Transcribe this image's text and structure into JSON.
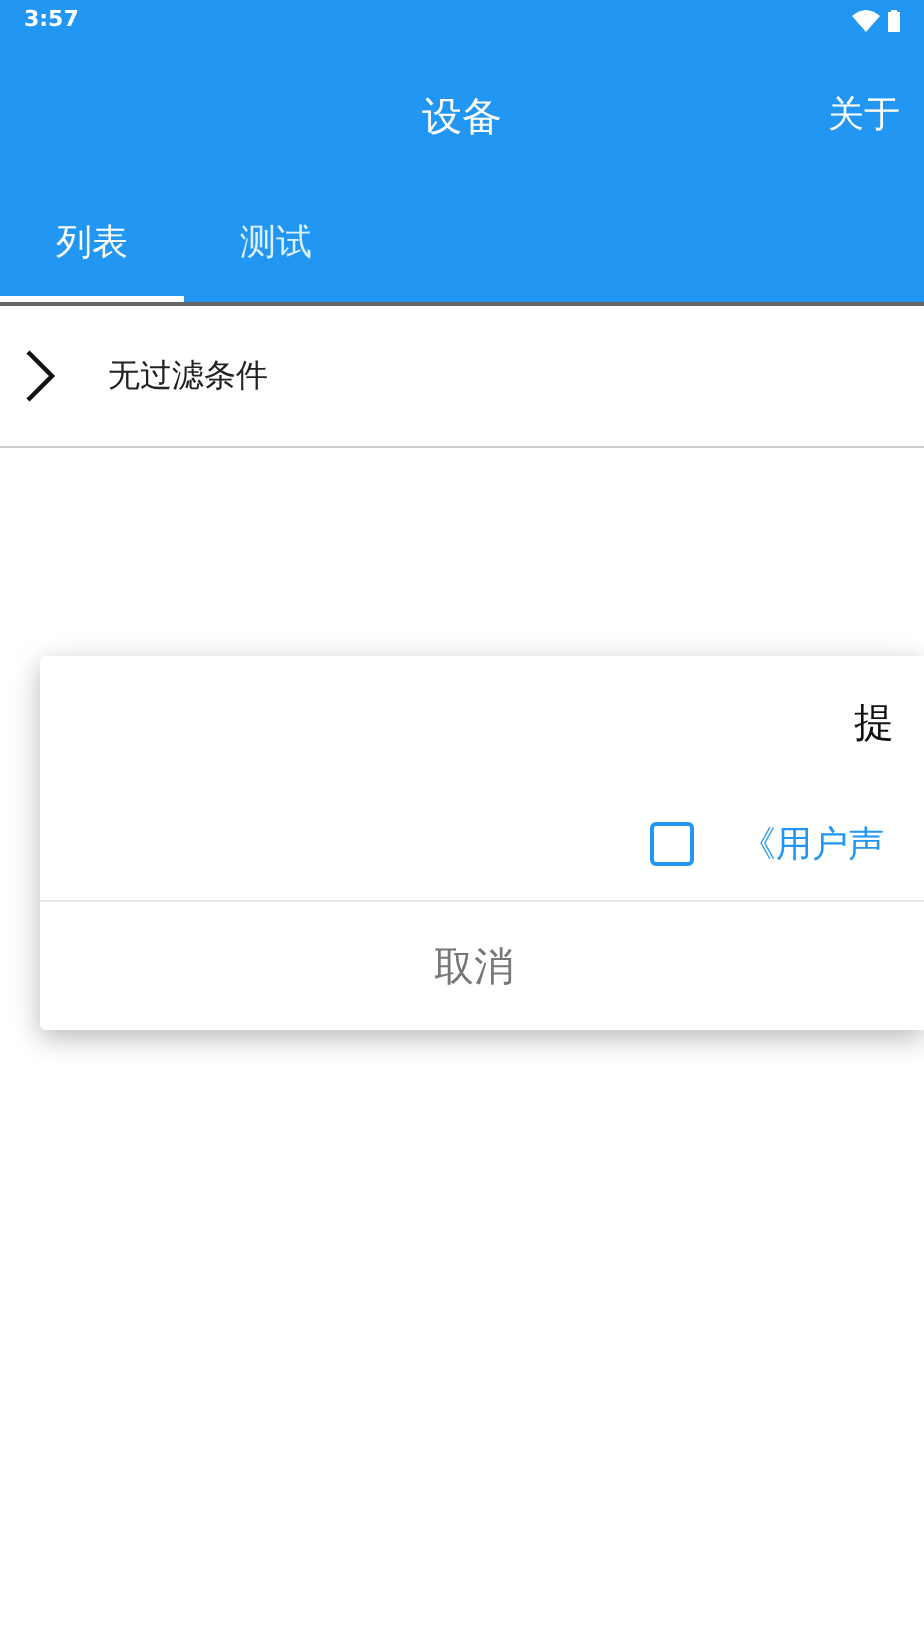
{
  "status_bar": {
    "time": "3:57"
  },
  "app_bar": {
    "title": "设备",
    "action": "关于"
  },
  "tabs": [
    {
      "label": "列表",
      "selected": true
    },
    {
      "label": "测试",
      "selected": false
    }
  ],
  "filter": {
    "label": "无过滤条件"
  },
  "dialog": {
    "title": "提",
    "agreement": {
      "checked": false,
      "link": "《用户声"
    },
    "cancel": "取消"
  }
}
